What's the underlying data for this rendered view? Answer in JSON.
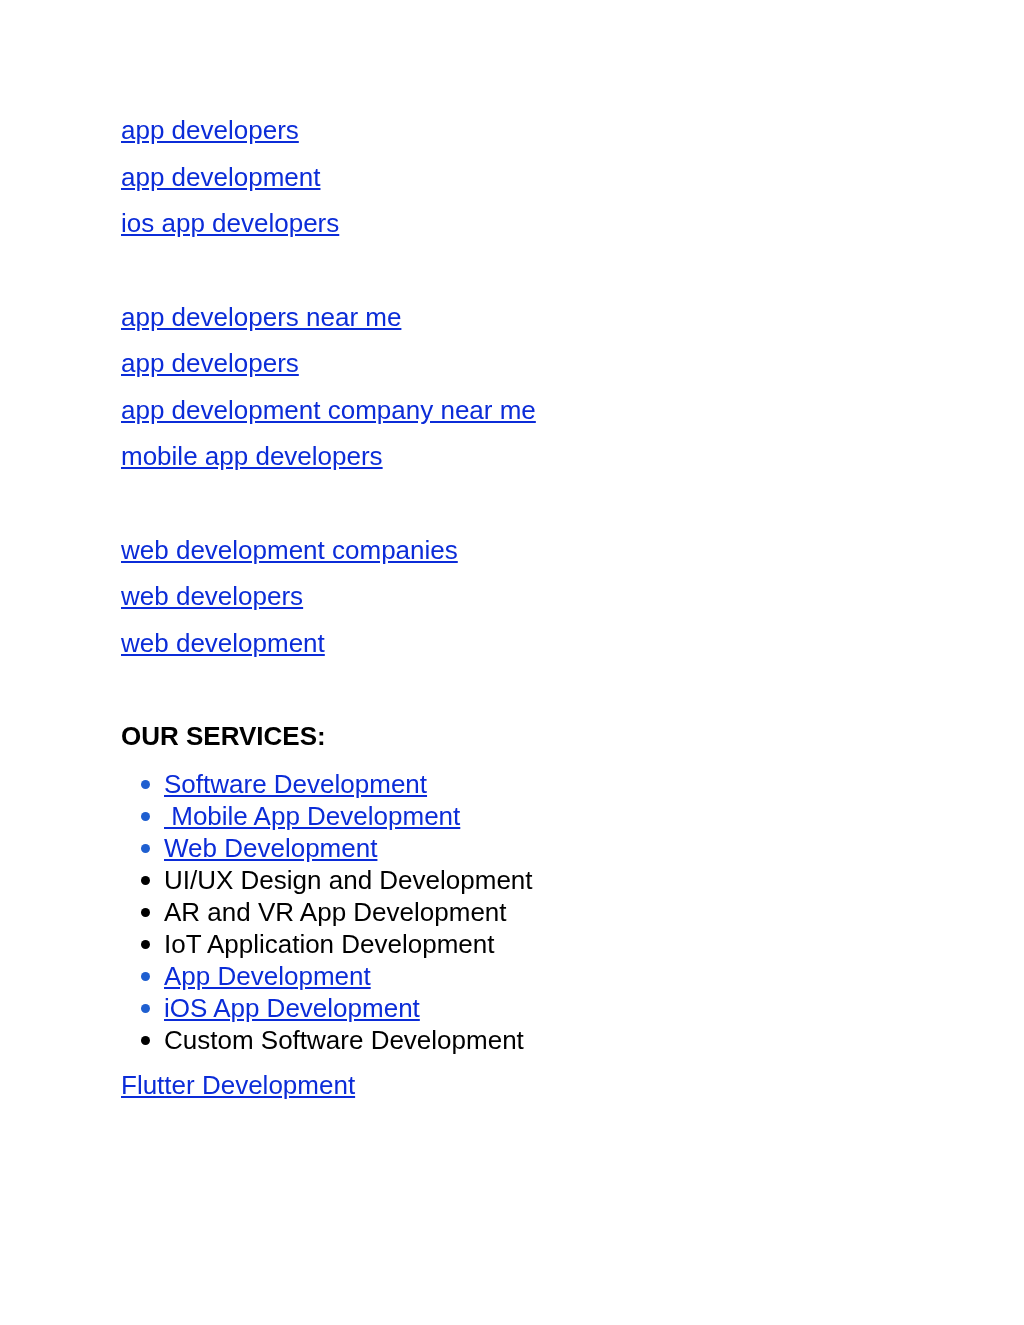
{
  "link_groups": [
    [
      "app developers",
      "app development",
      "ios app developers"
    ],
    [
      "app developers near me",
      "app developers",
      "app development company near me",
      "mobile app developers"
    ],
    [
      "web development companies",
      "web developers",
      "web development"
    ]
  ],
  "services": {
    "heading": "OUR SERVICES:",
    "items": [
      {
        "text": "Software Development",
        "link": true
      },
      {
        "text": " Mobile App Development",
        "link": true
      },
      {
        "text": "Web Development",
        "link": true
      },
      {
        "text": "UI/UX Design and Development",
        "link": false
      },
      {
        "text": "AR and VR App Development",
        "link": false
      },
      {
        "text": "IoT Application Development",
        "link": false
      },
      {
        "text": "App Development",
        "link": true
      },
      {
        "text": "iOS App Development",
        "link": true
      },
      {
        "text": "Custom Software Development",
        "link": false
      }
    ]
  },
  "footer_link": "Flutter Development"
}
